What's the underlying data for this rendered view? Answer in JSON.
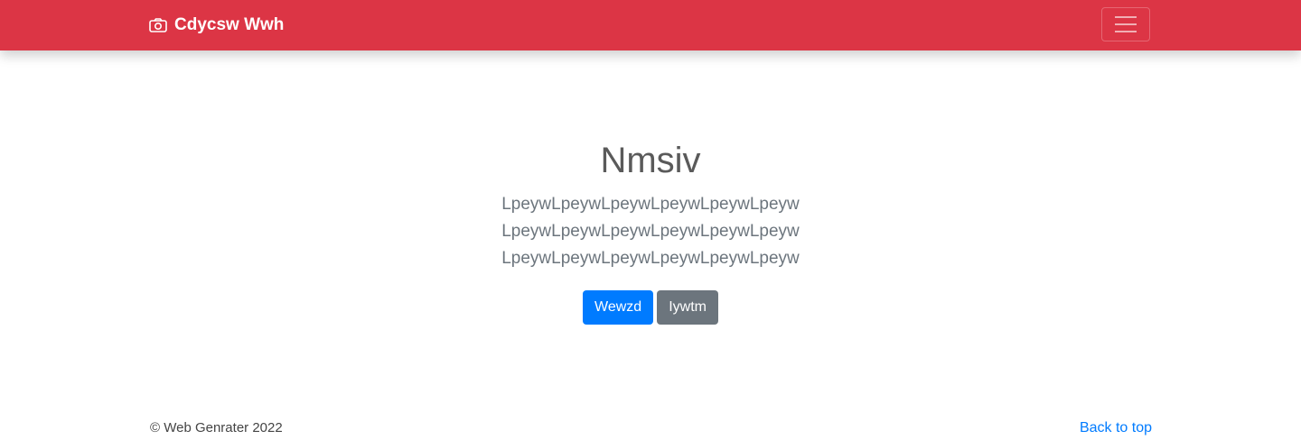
{
  "navbar": {
    "brand": "Cdycsw Wwh",
    "brand_icon": "camera-icon",
    "toggler_icon": "hamburger-icon",
    "background": "#dc3545"
  },
  "hero": {
    "title": "Nmsiv",
    "lead_lines": [
      "LpeywLpeywLpeywLpeywLpeywLpeyw",
      "LpeywLpeywLpeywLpeywLpeywLpeyw",
      "LpeywLpeywLpeywLpeywLpeywLpeyw"
    ],
    "primary_button": "Wewzd",
    "secondary_button": "Iywtm"
  },
  "footer": {
    "copyright": "© Web Genrater 2022",
    "back_to_top": "Back to top"
  }
}
